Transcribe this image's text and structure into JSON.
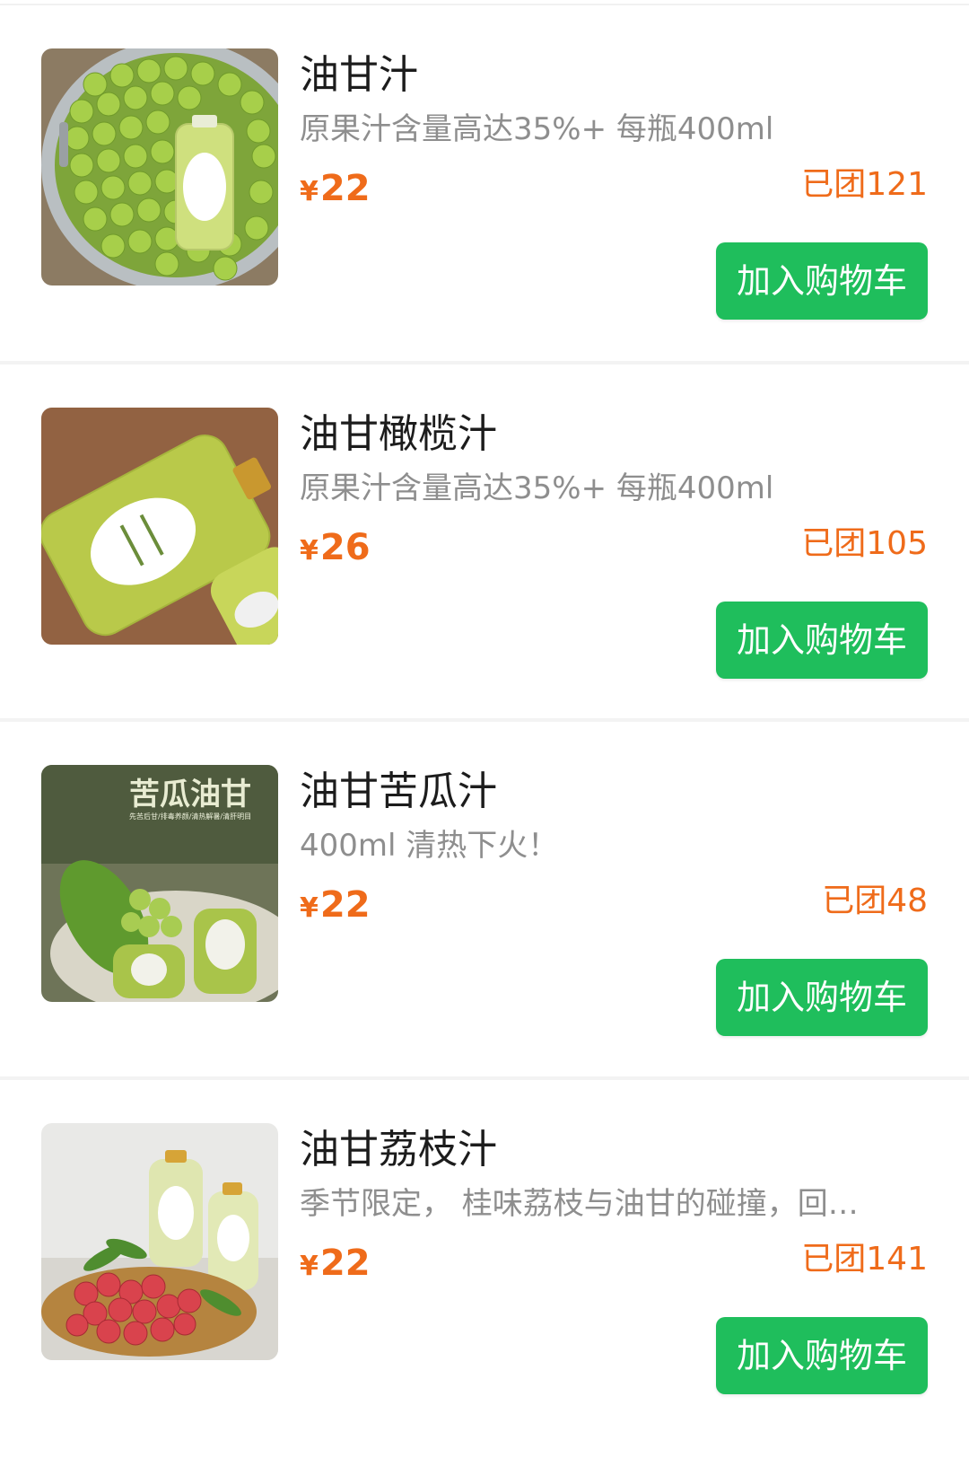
{
  "theme": {
    "accent_price": "#ef6b1a",
    "button_green": "#1fbe5c"
  },
  "products": [
    {
      "title": "油甘汁",
      "description": "原果汁含量高达35%+ 每瓶400ml",
      "currency": "¥",
      "price": "22",
      "sold": "已团121",
      "button_label": "加入购物车",
      "image": "amla-juice-bottle-on-fruit-pot"
    },
    {
      "title": "油甘橄榄汁",
      "description": "原果汁含量高达35%+ 每瓶400ml",
      "currency": "¥",
      "price": "26",
      "sold": "已团105",
      "button_label": "加入购物车",
      "image": "amla-olive-juice-bottles"
    },
    {
      "title": "油甘苦瓜汁",
      "description": "400ml 清热下火！",
      "currency": "¥",
      "price": "22",
      "sold": "已团48",
      "button_label": "加入购物车",
      "image": "bitter-melon-amla-juice",
      "image_text": "苦瓜油甘",
      "image_subtext": "先苦后甘/排毒养颜/清热解暑/清肝明目"
    },
    {
      "title": "油甘荔枝汁",
      "description": "季节限定， 桂味荔枝与油甘的碰撞，回…",
      "currency": "¥",
      "price": "22",
      "sold": "已团141",
      "button_label": "加入购物车",
      "image": "lychee-amla-juice-basket"
    }
  ]
}
